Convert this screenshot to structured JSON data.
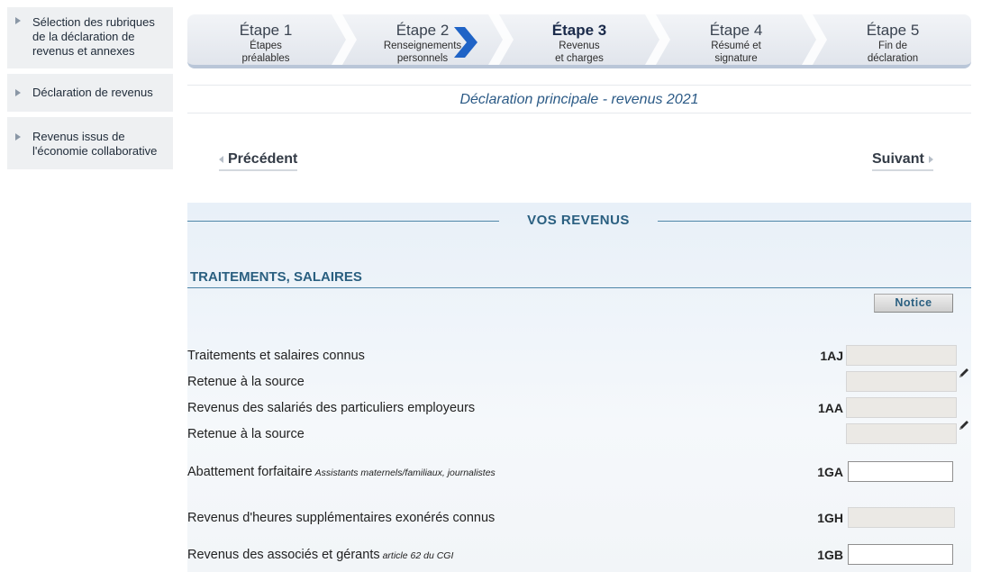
{
  "sidebar": {
    "items": [
      {
        "label": "Sélection des rubriques de la déclaration de revenus et annexes"
      },
      {
        "label": "Déclaration de revenus"
      },
      {
        "label": "Revenus issus de l'économie collaborative"
      }
    ]
  },
  "steps": [
    {
      "title": "Étape 1",
      "sub1": "Étapes",
      "sub2": "préalables"
    },
    {
      "title": "Étape 2",
      "sub1": "Renseignements",
      "sub2": "personnels"
    },
    {
      "title": "Étape 3",
      "sub1": "Revenus",
      "sub2": "et charges"
    },
    {
      "title": "Étape 4",
      "sub1": "Résumé et",
      "sub2": "signature"
    },
    {
      "title": "Étape 5",
      "sub1": "Fin de",
      "sub2": "déclaration"
    }
  ],
  "current_step": 3,
  "page_title": "Déclaration principale - revenus 2021",
  "nav": {
    "previous": "Précédent",
    "next": "Suivant"
  },
  "section": {
    "heading": "VOS REVENUS",
    "subheading": "TRAITEMENTS, SALAIRES",
    "notice_label": "Notice"
  },
  "rows": [
    {
      "label": "Traitements et salaires connus",
      "note": "",
      "code": "1AJ",
      "value": ""
    },
    {
      "label": "Retenue à la source",
      "note": "",
      "code": "",
      "value": ""
    },
    {
      "label": "Revenus des salariés des particuliers employeurs",
      "note": "",
      "code": "1AA",
      "value": ""
    },
    {
      "label": "Retenue à la source",
      "note": "",
      "code": "",
      "value": ""
    },
    {
      "label": "Abattement forfaitaire",
      "note": "Assistants maternels/familiaux, journalistes",
      "code": "1GA",
      "value": ""
    },
    {
      "label": "Revenus d'heures supplémentaires exonérés connus",
      "note": "",
      "code": "1GH",
      "value": ""
    },
    {
      "label": "Revenus des associés et gérants",
      "note": "article 62 du CGI",
      "code": "1GB",
      "value": ""
    }
  ],
  "icons": {
    "edit": "pencil-icon",
    "step_current": "chevron-right-icon",
    "bullet": "triangle-right-icon"
  },
  "colors": {
    "accent": "#2a5f80",
    "title_blue": "#2b5a86",
    "current_step_marker": "#1f63c6"
  }
}
